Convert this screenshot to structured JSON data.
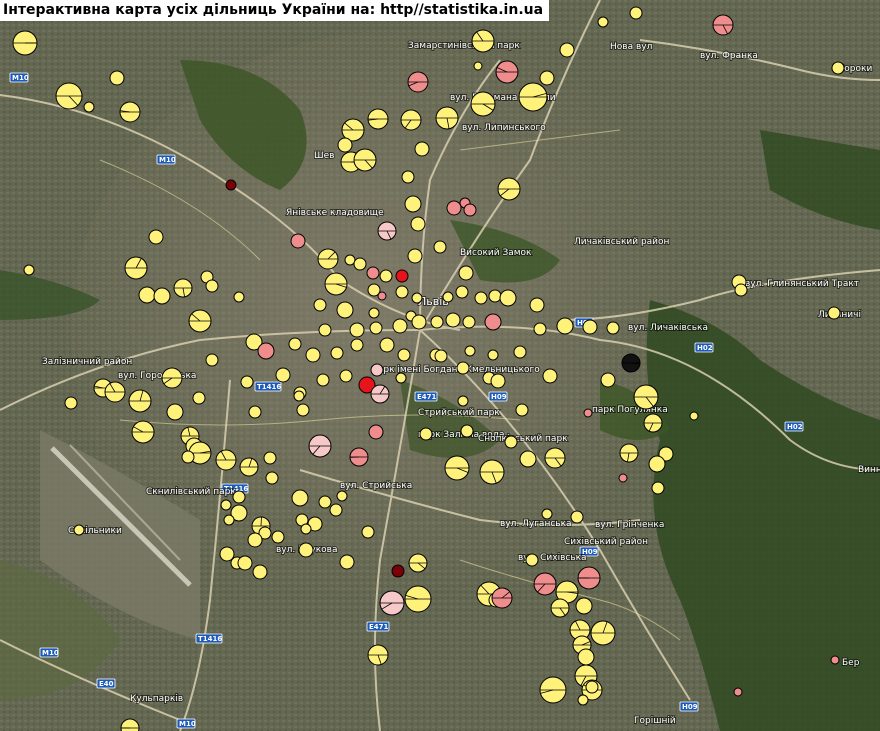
{
  "title": "Інтерактивна карта усіх дільниць України на: http//statistika.in.ua",
  "colors": {
    "yellow": "#fff27a",
    "pink": "#ef8d8d",
    "lightpink": "#f7c8c8",
    "red": "#e8141c",
    "darkred": "#7a0008",
    "black": "#111111"
  },
  "place_labels": [
    {
      "text": "Замарстинівський парк"
    },
    {
      "text": "Шев"
    },
    {
      "text": "Янівське кладовище"
    },
    {
      "text": "Личаківський район"
    },
    {
      "text": "Високий Замок"
    },
    {
      "text": "Львів"
    },
    {
      "text": "Залізничний район"
    },
    {
      "text": "парк імені Богдана Хмельницького"
    },
    {
      "text": "Стрийський парк"
    },
    {
      "text": "парк Залізна вода"
    },
    {
      "text": "Снопківський парк"
    },
    {
      "text": "парк Погулянка"
    },
    {
      "text": "Сихівський район"
    },
    {
      "text": "Скнилівський парк"
    },
    {
      "text": "Нова вул"
    },
    {
      "text": "вул. Франка"
    },
    {
      "text": "Сороки"
    },
    {
      "text": "вул. Гетьмана Мазепи"
    },
    {
      "text": "вул. Липинського"
    },
    {
      "text": "вул. Личаківська"
    },
    {
      "text": "вул. Городоцька"
    },
    {
      "text": "вул. Стрийська"
    },
    {
      "text": "вул. Наукова"
    },
    {
      "text": "вул. Сихівська"
    },
    {
      "text": "вул. Луганська"
    },
    {
      "text": "вул. Грінченка"
    },
    {
      "text": "вул. Глинянський Тракт"
    },
    {
      "text": "Винники"
    },
    {
      "text": "Горішній"
    },
    {
      "text": "Бер"
    },
    {
      "text": "Лисиничі"
    },
    {
      "text": "Сокільники"
    },
    {
      "text": "Кульпарків"
    }
  ],
  "route_shields": [
    "M10",
    "M10",
    "M10",
    "M10",
    "H02",
    "H02",
    "H02",
    "H09",
    "H09",
    "H09",
    "E471",
    "E471",
    "T1416",
    "T1416",
    "T1416",
    "E40"
  ],
  "markers": [
    {
      "c": "yellow"
    },
    {
      "c": "pink"
    },
    {
      "c": "lightpink"
    },
    {
      "c": "red"
    },
    {
      "c": "darkred"
    },
    {
      "c": "black"
    }
  ]
}
